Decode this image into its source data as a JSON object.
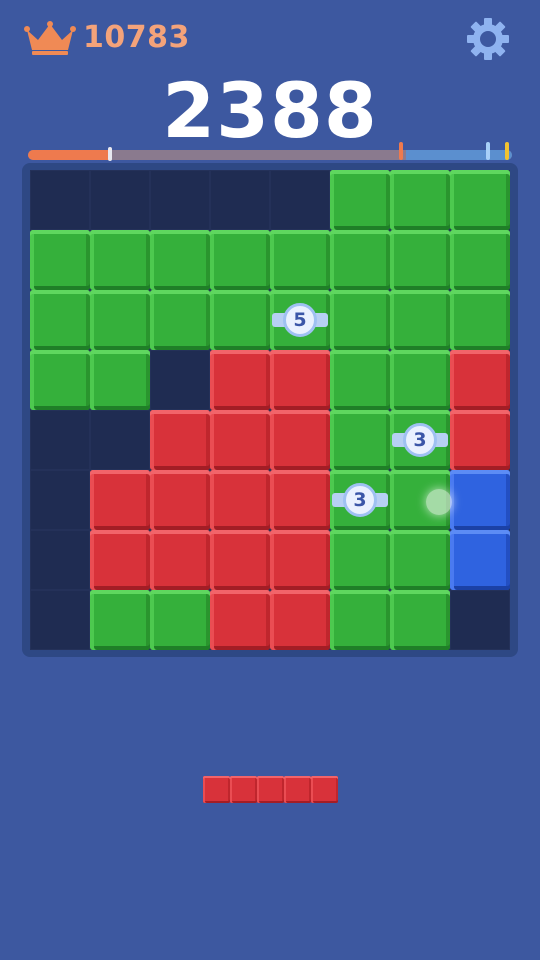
{
  "header": {
    "best_score": "10783",
    "score": "2388",
    "crown_icon": "crown-icon",
    "settings_icon": "gear-icon"
  },
  "progress": {
    "fill_fraction": 0.17,
    "blue_fraction": 0.22,
    "marker_colors": [
      "#e8e8f0",
      "#ee7a4e",
      "#a8d0f8",
      "#f2c230"
    ]
  },
  "colors": {
    "background": "#3d58a0",
    "green": "#35b03b",
    "red": "#d8323a",
    "blue": "#2f63e0",
    "best_score": "#f4a37a"
  },
  "board": {
    "rows": [
      [
        ".",
        ".",
        ".",
        ".",
        ".",
        "g",
        "g",
        "g"
      ],
      [
        "g",
        "g",
        "g",
        "g",
        "g",
        "g",
        "g",
        "g"
      ],
      [
        "g",
        "g",
        "g",
        "g",
        "g",
        "g",
        "g",
        "g"
      ],
      [
        "g",
        "g",
        ".",
        "r",
        "r",
        "g",
        "g",
        "r"
      ],
      [
        ".",
        ".",
        "r",
        "r",
        "r",
        "g",
        "g",
        "r"
      ],
      [
        ".",
        "r",
        "r",
        "r",
        "r",
        "g",
        "g",
        "b"
      ],
      [
        ".",
        "r",
        "r",
        "r",
        "r",
        "g",
        "g",
        "b"
      ],
      [
        ".",
        "g",
        "g",
        "r",
        "r",
        "g",
        "g",
        "."
      ]
    ],
    "badges": [
      {
        "row": 2,
        "col": 4,
        "value": "5"
      },
      {
        "row": 4,
        "col": 6,
        "value": "3"
      },
      {
        "row": 5,
        "col": 5,
        "value": "3"
      }
    ]
  },
  "tray": {
    "pieces": [
      {
        "color": "red",
        "length": 5,
        "orientation": "horizontal"
      }
    ]
  }
}
